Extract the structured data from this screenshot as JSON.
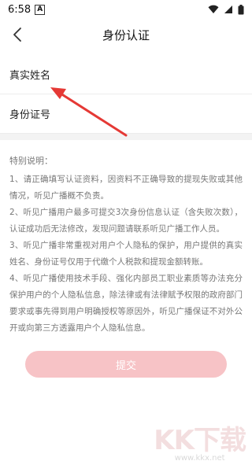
{
  "status_bar": {
    "time": "6:58",
    "notification_icon_label": "A"
  },
  "header": {
    "title": "身份认证"
  },
  "form": {
    "name_label": "真实姓名",
    "id_label": "身份证号"
  },
  "notice": {
    "title": "特别说明：",
    "items": [
      "1、请正确填写认证资料，因资料不正确导致的提现失败或其他情况，听见广播概不负责。",
      "2、听见广播用户最多可提交3次身份信息认证（含失败次数），认证成功后无法修改，发现问题请联系听见广播工作人员。",
      "3、听见广播非常重视对用户个人隐私的保护，用户提供的真实姓名、身份证号仅用于代缴个人税款和提现金额转账。",
      "4、听见广播使用技术手段、强化内部员工职业素质等办法充分保护用户的个人隐私信息，除法律或有法律赋予权限的政府部门要求或事先得到用户明确授权等原因外，听见广播保证不对外公开或向第三方透露用户个人隐私信息。"
    ]
  },
  "submit": {
    "label": "提交"
  },
  "watermark": {
    "logo": "KK下载",
    "url": "www.kkx.net"
  },
  "colors": {
    "submit_bg": "#f7c3c6",
    "arrow": "#e53935"
  }
}
